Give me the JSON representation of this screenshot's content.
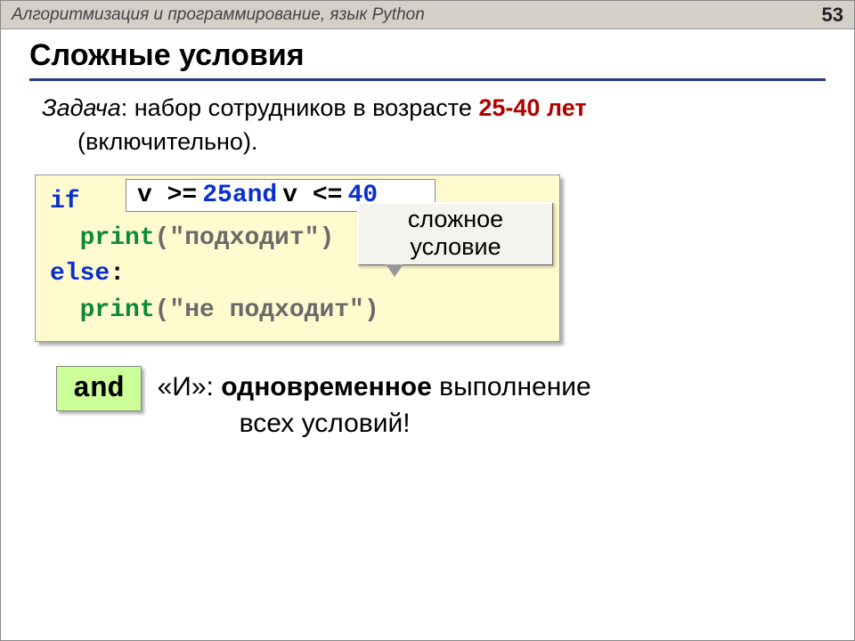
{
  "header": {
    "title": "Алгоритмизация и программирование, язык Python",
    "page": "53"
  },
  "heading": "Сложные условия",
  "task": {
    "label": "Задача",
    "before_age": ": набор сотрудников в возрасте ",
    "age": "25-40 лет",
    "line2": "(включительно)."
  },
  "callout": {
    "line1": "сложное",
    "line2": "условие"
  },
  "code": {
    "if_kw": "if",
    "cond_v1": "v >= ",
    "cond_n1": "25",
    "cond_and": " and ",
    "cond_v2": "v <= ",
    "cond_n2": "40",
    "colon": ":",
    "print_kw": "print",
    "str_ok": "(\"подходит\")",
    "else_kw": "else",
    "str_no": "(\"не подходит\")"
  },
  "and_block": {
    "box": "and",
    "l1_lead": "«И»: ",
    "l1_bold": "одновременное",
    "l1_tail": " выполнение",
    "l2": "всех условий!"
  }
}
